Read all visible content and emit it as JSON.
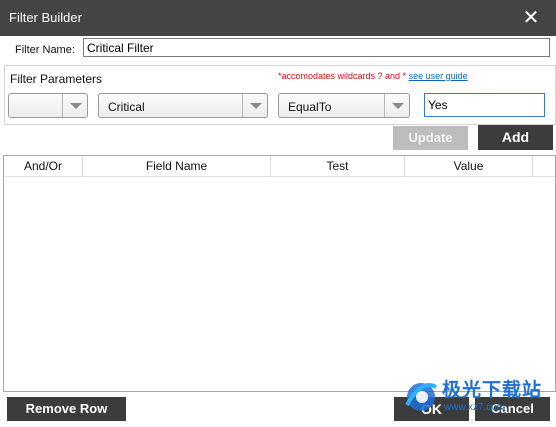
{
  "window": {
    "title": "Filter Builder",
    "close_icon": "close-icon"
  },
  "filter_name": {
    "label": "Filter Name:",
    "value": "Critical Filter"
  },
  "params": {
    "label": "Filter Parameters",
    "note": "*accomodates wildcards ? and * ",
    "guide_link": "see user guide",
    "andor_value": "",
    "field_value": "Critical",
    "test_value": "EqualTo",
    "value_input": "Yes"
  },
  "buttons": {
    "update": "Update",
    "add": "Add",
    "remove_row": "Remove Row",
    "ok": "OK",
    "cancel": "Cancel"
  },
  "grid": {
    "columns": [
      "And/Or",
      "Field Name",
      "Test",
      "Value"
    ],
    "rows": []
  },
  "watermark": {
    "text": "极光下载站",
    "url": "www.xz7.com"
  },
  "colors": {
    "titlebar": "#444444",
    "button_dark": "#3c3c3c",
    "button_disabled": "#bdbdbd",
    "note_red": "#cc1111",
    "link_blue": "#1565c0"
  }
}
